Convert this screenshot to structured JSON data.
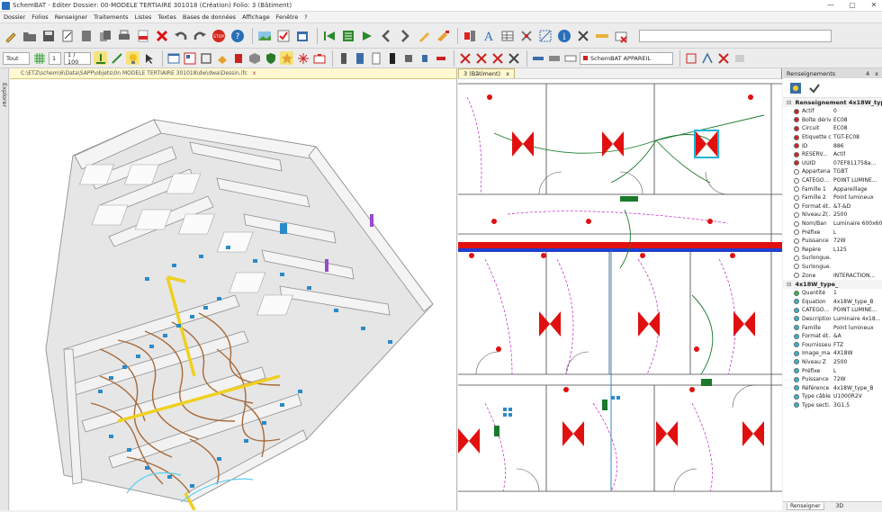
{
  "window": {
    "title": "SchemBAT - Editer Dossier: 00-MODELE TERTIAIRE 301018 (Création) Folio: 3 (Bâtiment)",
    "buttons": [
      "—",
      "▢",
      "✕"
    ]
  },
  "menu": [
    "Dossier",
    "Folios",
    "Renseigner",
    "Traitements",
    "Listes",
    "Textes",
    "Bases de données",
    "Affichage",
    "Fenêtre",
    "?"
  ],
  "toolbar2": {
    "layer_select": "Tout",
    "scale_num": "1",
    "scale_den": "1 / 100",
    "appareil_select": "SchemBAT APPAREIL"
  },
  "explorer": {
    "label": "Explorer"
  },
  "panel3d": {
    "tab_path": "C:\\ETZ\\schem\\6\\Data\\SAPP\\objets\\0n MODELE TERTIAIRE 301018\\dw\\dwa\\Dessin.ifc",
    "close": "x"
  },
  "panelplan": {
    "tab_label": "3  (Bâtiment)",
    "close": "x"
  },
  "props": {
    "header": "Renseignements",
    "pin": "4",
    "close": "x",
    "section1_title": "Renseignement 4x18W_type_B",
    "rows1": [
      {
        "k": "Actif",
        "v": "0",
        "c": "#d62020"
      },
      {
        "k": "Boîte dériv...",
        "v": "EC08",
        "c": "#d62020"
      },
      {
        "k": "Circuit",
        "v": "EC08",
        "c": "#d62020"
      },
      {
        "k": "Etiquette c...",
        "v": "TGT-EC08",
        "c": "#d62020"
      },
      {
        "k": "ID",
        "v": "886",
        "c": "#d62020"
      },
      {
        "k": "RESERV...",
        "v": "Actif",
        "c": "#d62020"
      },
      {
        "k": "UUID",
        "v": "07EF811758a...",
        "c": "#d62020"
      },
      {
        "k": "Appartenan...",
        "v": "TGBT",
        "c": "#ffffff"
      },
      {
        "k": "CATEGO...",
        "v": "POINT LUMINE...",
        "c": "#ffffff"
      },
      {
        "k": "Famille 1",
        "v": "Appareillage",
        "c": "#ffffff"
      },
      {
        "k": "Famille 2",
        "v": "Point lumineux",
        "c": "#ffffff"
      },
      {
        "k": "Format ét...",
        "v": "&T-&D",
        "c": "#ffffff"
      },
      {
        "k": "Niveau Z(...",
        "v": "2500",
        "c": "#ffffff"
      },
      {
        "k": "Nom/Ban",
        "v": "Luminaire 600x600",
        "c": "#ffffff"
      },
      {
        "k": "Préfixe",
        "v": "L",
        "c": "#ffffff"
      },
      {
        "k": "Puissance",
        "v": "72W",
        "c": "#ffffff"
      },
      {
        "k": "Repère",
        "v": "L125",
        "c": "#ffffff"
      },
      {
        "k": "Surlongue...",
        "v": "",
        "c": "#ffffff"
      },
      {
        "k": "Surlongue...",
        "v": "",
        "c": "#ffffff"
      },
      {
        "k": "Zone",
        "v": "INTERACTION...",
        "c": "#ffffff"
      }
    ],
    "section2_title": "4x18W_type_",
    "rows2": [
      {
        "k": "Quantité",
        "v": "1",
        "c": "#2fbf3f"
      },
      {
        "k": "Equation",
        "v": "4x18W_type_B",
        "c": "#2bb9d8"
      },
      {
        "k": "CATEGO...",
        "v": "POINT LUMINE...",
        "c": "#2bb9d8"
      },
      {
        "k": "Description",
        "v": "Luminaire 4x18...",
        "c": "#2bb9d8"
      },
      {
        "k": "Famille",
        "v": "Point lumineux",
        "c": "#2bb9d8"
      },
      {
        "k": "Format ét...",
        "v": "&A",
        "c": "#2bb9d8"
      },
      {
        "k": "Fournisseur",
        "v": "FTZ",
        "c": "#2bb9d8"
      },
      {
        "k": "Image_ma...",
        "v": "4X18W",
        "c": "#2bb9d8"
      },
      {
        "k": "Niveau Z",
        "v": "2500",
        "c": "#2bb9d8"
      },
      {
        "k": "Préfixe",
        "v": "L",
        "c": "#2bb9d8"
      },
      {
        "k": "Puissance",
        "v": "72W",
        "c": "#2bb9d8"
      },
      {
        "k": "Référence",
        "v": "4x18W_type_B",
        "c": "#2bb9d8"
      },
      {
        "k": "Type câble",
        "v": "U1000R2V",
        "c": "#2bb9d8"
      },
      {
        "k": "Type secti...",
        "v": "3G1.5",
        "c": "#2bb9d8"
      }
    ],
    "tabs": [
      "Renseigner",
      "3D"
    ]
  },
  "colors": {
    "accent": "#2a6fb8",
    "plan_red": "#e01010",
    "plan_green": "#1a7a2a",
    "plan_blue": "#1f3fd0",
    "plan_magenta": "#c020c0"
  }
}
